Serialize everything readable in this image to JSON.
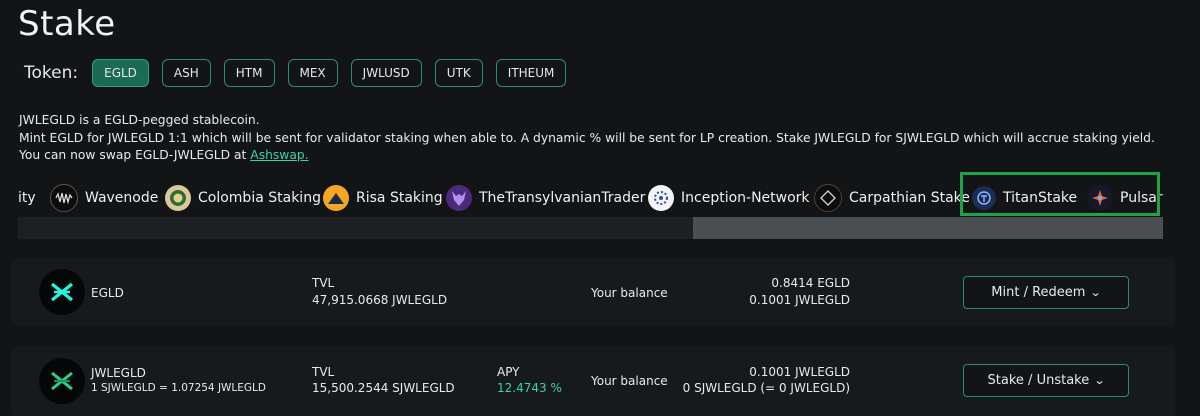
{
  "page": {
    "title": "Stake"
  },
  "tokens": {
    "label": "Token:",
    "items": [
      {
        "label": "EGLD",
        "active": true
      },
      {
        "label": "ASH",
        "active": false
      },
      {
        "label": "HTM",
        "active": false
      },
      {
        "label": "MEX",
        "active": false
      },
      {
        "label": "JWLUSD",
        "active": false
      },
      {
        "label": "UTK",
        "active": false
      },
      {
        "label": "ITHEUM",
        "active": false
      }
    ]
  },
  "description": {
    "line1": "JWLEGLD is a EGLD-pegged stablecoin.",
    "line2": "Mint EGLD for JWLEGLD 1:1 which will be sent for validator staking when able to. A dynamic % will be sent for LP creation. Stake JWLEGLD for SJWLEGLD which will accrue staking yield.",
    "line3_prefix": "You can now swap EGLD-JWLEGLD at ",
    "link": "Ashswap."
  },
  "validators": [
    {
      "name": "ity",
      "icon": "none"
    },
    {
      "name": "Wavenode",
      "icon": "wavenode-logo-icon"
    },
    {
      "name": "Colombia Staking",
      "icon": "colombia-staking-logo-icon"
    },
    {
      "name": "Risa Staking",
      "icon": "risa-staking-logo-icon"
    },
    {
      "name": "TheTransylvanianTrader",
      "icon": "wolf-logo-icon"
    },
    {
      "name": "Inception-Network",
      "icon": "inception-logo-icon"
    },
    {
      "name": "Carpathian Stake",
      "icon": "carpathian-logo-icon"
    },
    {
      "name": "TitanStake",
      "icon": "titanstake-logo-icon"
    },
    {
      "name": "Pulsar",
      "icon": "pulsar-logo-icon"
    }
  ],
  "rows": [
    {
      "token": "EGLD",
      "tvl_label": "TVL",
      "tvl_value": "47,915.0668 JWLEGLD",
      "balance_label": "Your balance",
      "balance_line1": "0.8414 EGLD",
      "balance_line2": "0.1001 JWLEGLD",
      "action": "Mint / Redeem"
    },
    {
      "token": "JWLEGLD",
      "token_sub": "1 SJWLEGLD = 1.07254 JWLEGLD",
      "tvl_label": "TVL",
      "tvl_value": "15,500.2544 SJWLEGLD",
      "apy_label": "APY",
      "apy_value": "12.4743 %",
      "balance_label": "Your balance",
      "balance_line1": "0.1001 JWLEGLD",
      "balance_line2": "0 SJWLEGLD (= 0 JWLEGLD)",
      "action": "Stake / Unstake"
    }
  ],
  "colors": {
    "background": "#121416",
    "accent": "#3fd1a3",
    "active_token": "#1a6b52",
    "highlight": "#1fa34a"
  }
}
